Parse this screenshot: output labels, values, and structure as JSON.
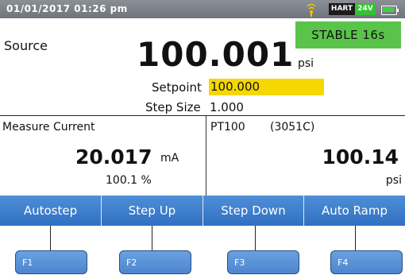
{
  "status": {
    "datetime": "01/01/2017 01:26 pm",
    "hart_label": "HART",
    "voltage_label": "24V",
    "icons": [
      "wireless-icon",
      "battery-icon"
    ]
  },
  "source": {
    "label": "Source",
    "stable_label": "STABLE 16s",
    "value": "100.001",
    "unit": "psi",
    "setpoint_label": "Setpoint",
    "setpoint_value": "100.000",
    "stepsize_label": "Step Size",
    "stepsize_value": "1.000"
  },
  "measure": {
    "label": "Measure Current",
    "value": "20.017",
    "unit": "mA",
    "percent": "100.1 %"
  },
  "sensor": {
    "label": "PT100",
    "model": "(3051C)",
    "value": "100.14",
    "unit": "psi"
  },
  "softkeys": [
    "Autostep",
    "Step Up",
    "Step Down",
    "Auto Ramp"
  ],
  "fkeys": [
    "F1",
    "F2",
    "F3",
    "F4"
  ],
  "colors": {
    "stable_bg": "#5ac44a",
    "setpoint_bg": "#f5d800",
    "softkey_bg": "#3f7fcc",
    "status_bg": "#7a7e86"
  }
}
